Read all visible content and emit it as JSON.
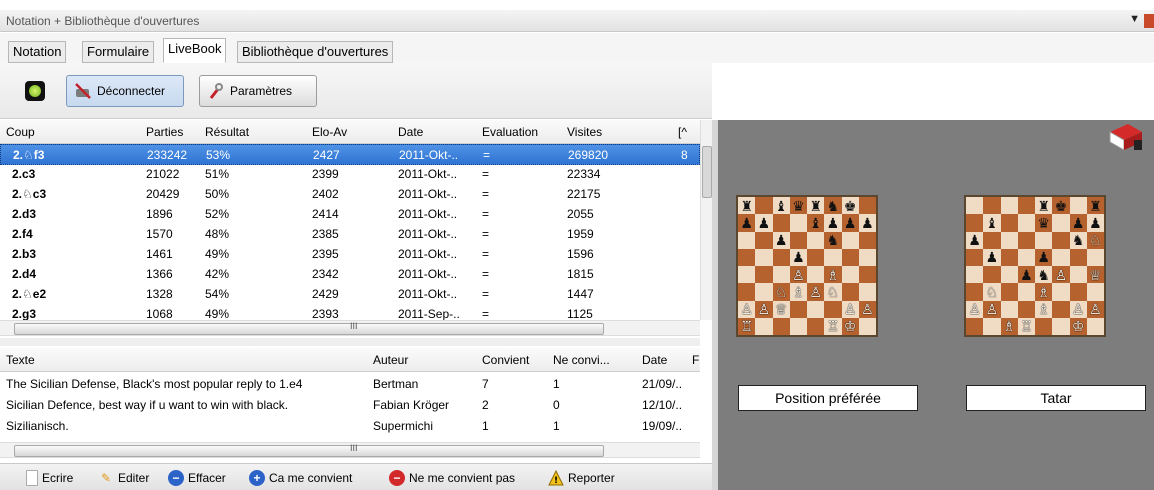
{
  "window": {
    "title": "Notation + Bibliothèque d'ouvertures",
    "menu_glyph": "▼"
  },
  "tabs": [
    "Notation",
    "Formulaire",
    "LiveBook",
    "Bibliothèque d'ouvertures"
  ],
  "toolbar": {
    "disconnect_label": "Déconnecter",
    "settings_label": "Paramètres"
  },
  "moves_table": {
    "columns": [
      "Coup",
      "Parties",
      "Résultat",
      "Elo-Av",
      "Date",
      "Evaluation",
      "Visites",
      "[^"
    ],
    "rows": [
      {
        "move": "2.♘f3",
        "games": "233242",
        "result": "53%",
        "elo": "2427",
        "date": "2011-Okt-..",
        "eval": "=",
        "visits": "269820",
        "extra": "8"
      },
      {
        "move": "2.c3",
        "games": "21022",
        "result": "51%",
        "elo": "2399",
        "date": "2011-Okt-..",
        "eval": "=",
        "visits": "22334",
        "extra": ""
      },
      {
        "move": "2.♘c3",
        "games": "20429",
        "result": "50%",
        "elo": "2402",
        "date": "2011-Okt-..",
        "eval": "=",
        "visits": "22175",
        "extra": ""
      },
      {
        "move": "2.d3",
        "games": "1896",
        "result": "52%",
        "elo": "2414",
        "date": "2011-Okt-..",
        "eval": "=",
        "visits": "2055",
        "extra": ""
      },
      {
        "move": "2.f4",
        "games": "1570",
        "result": "48%",
        "elo": "2385",
        "date": "2011-Okt-..",
        "eval": "=",
        "visits": "1959",
        "extra": ""
      },
      {
        "move": "2.b3",
        "games": "1461",
        "result": "49%",
        "elo": "2395",
        "date": "2011-Okt-..",
        "eval": "=",
        "visits": "1596",
        "extra": ""
      },
      {
        "move": "2.d4",
        "games": "1366",
        "result": "42%",
        "elo": "2342",
        "date": "2011-Okt-..",
        "eval": "=",
        "visits": "1815",
        "extra": ""
      },
      {
        "move": "2.♘e2",
        "games": "1328",
        "result": "54%",
        "elo": "2429",
        "date": "2011-Okt-..",
        "eval": "=",
        "visits": "1447",
        "extra": ""
      },
      {
        "move": "2.g3",
        "games": "1068",
        "result": "49%",
        "elo": "2393",
        "date": "2011-Sep-..",
        "eval": "=",
        "visits": "1125",
        "extra": ""
      }
    ]
  },
  "comments_table": {
    "columns": [
      "Texte",
      "Auteur",
      "Convient",
      "Ne convi...",
      "Date",
      "F"
    ],
    "rows": [
      {
        "text": "The Sicilian Defense, Black's most popular reply to 1.e4",
        "author": "Bertman",
        "agree": "7",
        "disagree": "1",
        "date": "21/09/.."
      },
      {
        "text": "Sicilian Defence, best way if u want to win with black.",
        "author": "Fabian Kröger",
        "agree": "2",
        "disagree": "0",
        "date": "12/10/.."
      },
      {
        "text": "Sizilianisch.",
        "author": "Supermichi",
        "agree": "1",
        "disagree": "1",
        "date": "19/09/.."
      }
    ]
  },
  "bottom_actions": {
    "write": "Ecrire",
    "edit": "Editer",
    "delete": "Effacer",
    "like": "Ca me convient",
    "dislike": "Ne me convient pas",
    "report": "Reporter"
  },
  "boards": {
    "left_label": "Position préférée",
    "right_label": "Tatar",
    "left_position": [
      "♜ ♝♛♜♞♚ ",
      "♟♟  ♝♟♟♟",
      "  ♟  ♞  ",
      "   ♟    ",
      "   ♙ ♗  ",
      "  ♘♗♙♘  ",
      "♙♙♕   ♙♙",
      "♖    ♖♔ "
    ],
    "right_position": [
      "    ♜♚ ♜",
      " ♝  ♛ ♟♟",
      "♟     ♞♘",
      " ♟  ♟   ",
      "   ♟♞♙ ♕",
      " ♘  ♗   ",
      "♙♙  ♗ ♙♙",
      "  ♗♖  ♔ "
    ]
  },
  "scroll_grip": "III",
  "colors": {
    "selection": "#3a7fdc",
    "board_dark": "#b5622e",
    "board_light": "#f0dcc5",
    "right_background": "#7d7d7d"
  }
}
